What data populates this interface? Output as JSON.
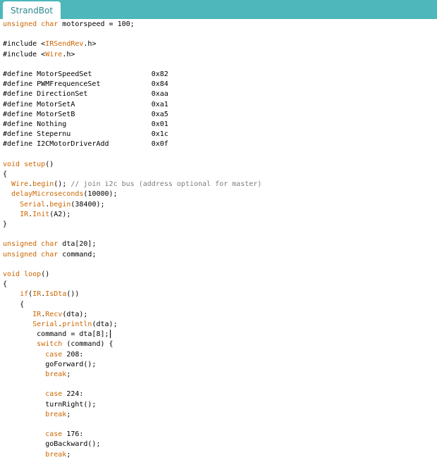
{
  "tab": {
    "label": "StrandBot"
  },
  "colors": {
    "tab_bar": "#4db7bb",
    "keyword": "#cc6600",
    "comment": "#7e7e7e"
  },
  "code_lines": [
    {
      "y": 0,
      "segments": [
        {
          "t": "unsigned char",
          "c": "kw"
        },
        {
          "t": " motorspeed = 100;",
          "c": ""
        }
      ]
    },
    {
      "y": 2,
      "segments": [
        {
          "t": "#include <",
          "c": ""
        },
        {
          "t": "IRSendRev",
          "c": "kw"
        },
        {
          "t": ".h>",
          "c": ""
        }
      ]
    },
    {
      "y": 3,
      "segments": [
        {
          "t": "#include <",
          "c": ""
        },
        {
          "t": "Wire",
          "c": "kw"
        },
        {
          "t": ".h>",
          "c": ""
        }
      ]
    },
    {
      "y": 5,
      "segments": [
        {
          "t": "#define MotorSpeedSet              0x82",
          "c": ""
        }
      ]
    },
    {
      "y": 6,
      "segments": [
        {
          "t": "#define PWMFrequenceSet            0x84",
          "c": ""
        }
      ]
    },
    {
      "y": 7,
      "segments": [
        {
          "t": "#define DirectionSet               0xaa",
          "c": ""
        }
      ]
    },
    {
      "y": 8,
      "segments": [
        {
          "t": "#define MotorSetA                  0xa1",
          "c": ""
        }
      ]
    },
    {
      "y": 9,
      "segments": [
        {
          "t": "#define MotorSetB                  0xa5",
          "c": ""
        }
      ]
    },
    {
      "y": 10,
      "segments": [
        {
          "t": "#define Nothing                    0x01",
          "c": ""
        }
      ]
    },
    {
      "y": 11,
      "segments": [
        {
          "t": "#define Stepernu                   0x1c",
          "c": ""
        }
      ]
    },
    {
      "y": 12,
      "segments": [
        {
          "t": "#define I2CMotorDriverAdd          0x0f",
          "c": ""
        }
      ]
    },
    {
      "y": 14,
      "segments": [
        {
          "t": "void",
          "c": "kw"
        },
        {
          "t": " ",
          "c": ""
        },
        {
          "t": "setup",
          "c": "kw"
        },
        {
          "t": "()",
          "c": ""
        }
      ]
    },
    {
      "y": 15,
      "segments": [
        {
          "t": "{",
          "c": ""
        }
      ]
    },
    {
      "y": 16,
      "segments": [
        {
          "t": "  ",
          "c": ""
        },
        {
          "t": "Wire",
          "c": "kw"
        },
        {
          "t": ".",
          "c": ""
        },
        {
          "t": "begin",
          "c": "kw"
        },
        {
          "t": "(); ",
          "c": ""
        },
        {
          "t": "// join i2c bus (address optional for master)",
          "c": "cm"
        }
      ]
    },
    {
      "y": 17,
      "segments": [
        {
          "t": "  ",
          "c": ""
        },
        {
          "t": "delayMicroseconds",
          "c": "kw"
        },
        {
          "t": "(10000);",
          "c": ""
        }
      ]
    },
    {
      "y": 18,
      "segments": [
        {
          "t": "    ",
          "c": ""
        },
        {
          "t": "Serial",
          "c": "kw"
        },
        {
          "t": ".",
          "c": ""
        },
        {
          "t": "begin",
          "c": "kw"
        },
        {
          "t": "(38400);",
          "c": ""
        }
      ]
    },
    {
      "y": 19,
      "segments": [
        {
          "t": "    ",
          "c": ""
        },
        {
          "t": "IR",
          "c": "kw"
        },
        {
          "t": ".",
          "c": ""
        },
        {
          "t": "Init",
          "c": "kw"
        },
        {
          "t": "(A2);",
          "c": ""
        }
      ]
    },
    {
      "y": 20,
      "segments": [
        {
          "t": "}",
          "c": ""
        }
      ]
    },
    {
      "y": 22,
      "segments": [
        {
          "t": "unsigned char",
          "c": "kw"
        },
        {
          "t": " dta[20];",
          "c": ""
        }
      ]
    },
    {
      "y": 23,
      "segments": [
        {
          "t": "unsigned char",
          "c": "kw"
        },
        {
          "t": " command;",
          "c": ""
        }
      ]
    },
    {
      "y": 25,
      "segments": [
        {
          "t": "void",
          "c": "kw"
        },
        {
          "t": " ",
          "c": ""
        },
        {
          "t": "loop",
          "c": "kw"
        },
        {
          "t": "()",
          "c": ""
        }
      ]
    },
    {
      "y": 26,
      "segments": [
        {
          "t": "{",
          "c": ""
        }
      ]
    },
    {
      "y": 27,
      "segments": [
        {
          "t": "    ",
          "c": ""
        },
        {
          "t": "if",
          "c": "kw"
        },
        {
          "t": "(",
          "c": ""
        },
        {
          "t": "IR",
          "c": "kw"
        },
        {
          "t": ".",
          "c": ""
        },
        {
          "t": "IsDta",
          "c": "kw"
        },
        {
          "t": "())",
          "c": ""
        }
      ]
    },
    {
      "y": 28,
      "segments": [
        {
          "t": "    {",
          "c": ""
        }
      ]
    },
    {
      "y": 29,
      "segments": [
        {
          "t": "       ",
          "c": ""
        },
        {
          "t": "IR",
          "c": "kw"
        },
        {
          "t": ".",
          "c": ""
        },
        {
          "t": "Recv",
          "c": "kw"
        },
        {
          "t": "(dta);",
          "c": ""
        }
      ]
    },
    {
      "y": 30,
      "segments": [
        {
          "t": "       ",
          "c": ""
        },
        {
          "t": "Serial",
          "c": "kw"
        },
        {
          "t": ".",
          "c": ""
        },
        {
          "t": "println",
          "c": "kw"
        },
        {
          "t": "(dta);",
          "c": ""
        }
      ]
    },
    {
      "y": 31,
      "segments": [
        {
          "t": "        command = dta[8];",
          "c": ""
        }
      ],
      "caret": true
    },
    {
      "y": 32,
      "segments": [
        {
          "t": "        ",
          "c": ""
        },
        {
          "t": "switch",
          "c": "kw"
        },
        {
          "t": " (command) {",
          "c": ""
        }
      ]
    },
    {
      "y": 33,
      "segments": [
        {
          "t": "          ",
          "c": ""
        },
        {
          "t": "case",
          "c": "kw"
        },
        {
          "t": " 208:",
          "c": ""
        }
      ]
    },
    {
      "y": 34,
      "segments": [
        {
          "t": "          goForward();",
          "c": ""
        }
      ]
    },
    {
      "y": 35,
      "segments": [
        {
          "t": "          ",
          "c": ""
        },
        {
          "t": "break",
          "c": "kw"
        },
        {
          "t": ";",
          "c": ""
        }
      ]
    },
    {
      "y": 37,
      "segments": [
        {
          "t": "          ",
          "c": ""
        },
        {
          "t": "case",
          "c": "kw"
        },
        {
          "t": " 224:",
          "c": ""
        }
      ]
    },
    {
      "y": 38,
      "segments": [
        {
          "t": "          turnRight();",
          "c": ""
        }
      ]
    },
    {
      "y": 39,
      "segments": [
        {
          "t": "          ",
          "c": ""
        },
        {
          "t": "break",
          "c": "kw"
        },
        {
          "t": ";",
          "c": ""
        }
      ]
    },
    {
      "y": 41,
      "segments": [
        {
          "t": "          ",
          "c": ""
        },
        {
          "t": "case",
          "c": "kw"
        },
        {
          "t": " 176:",
          "c": ""
        }
      ]
    },
    {
      "y": 42,
      "segments": [
        {
          "t": "          goBackward();",
          "c": ""
        }
      ]
    },
    {
      "y": 43,
      "segments": [
        {
          "t": "          ",
          "c": ""
        },
        {
          "t": "break",
          "c": "kw"
        },
        {
          "t": ";",
          "c": ""
        }
      ]
    }
  ]
}
